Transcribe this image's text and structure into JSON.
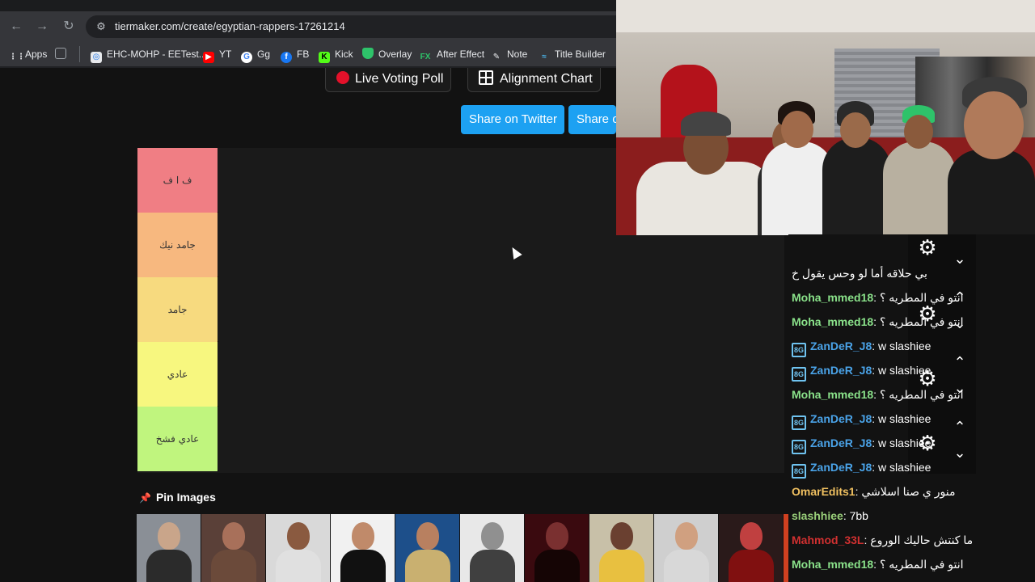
{
  "browser": {
    "url": "tiermaker.com/create/egyptian-rappers-17261214",
    "bookmarks": [
      {
        "label": "Apps",
        "icon": "apps-grid-icon"
      },
      {
        "label": "",
        "icon": "tab-groups-icon"
      },
      {
        "label": "EHC-MOHP - EETest...",
        "icon": "globe-icon"
      },
      {
        "label": "YT",
        "icon": "youtube-icon"
      },
      {
        "label": "Gg",
        "icon": "google-icon"
      },
      {
        "label": "FB",
        "icon": "facebook-icon"
      },
      {
        "label": "Kick",
        "icon": "kick-icon"
      },
      {
        "label": "Overlay",
        "icon": "shield-icon"
      },
      {
        "label": "After Effect",
        "icon": "fx-icon"
      },
      {
        "label": "Note",
        "icon": "note-icon"
      },
      {
        "label": "Title Builder",
        "icon": "wave-icon"
      }
    ]
  },
  "toolbar": {
    "live_voting": "Live Voting Poll",
    "alignment_chart": "Alignment Chart",
    "share_twitter": "Share on Twitter",
    "share_other": "Share o"
  },
  "tiers": [
    {
      "label": "ف ا ف",
      "color": "#f07e84"
    },
    {
      "label": "جامد نيك",
      "color": "#f7b87f"
    },
    {
      "label": "جامد",
      "color": "#f7da7f"
    },
    {
      "label": "عادي",
      "color": "#f7f77f"
    },
    {
      "label": "عادي فشخ",
      "color": "#c0f57e"
    }
  ],
  "pool": {
    "title": "Pin Images",
    "thumbs": [
      {
        "bg": "#8a8f96",
        "skin": "#c9a58a",
        "shirt": "#2b2b2b"
      },
      {
        "bg": "#5a4038",
        "skin": "#a8705a",
        "shirt": "#6b4a3a"
      },
      {
        "bg": "#d9d9d9",
        "skin": "#8a5a40",
        "shirt": "#e0e0e0"
      },
      {
        "bg": "#f1f1f1",
        "skin": "#c08a6a",
        "shirt": "#111111"
      },
      {
        "bg": "#1d4f8a",
        "skin": "#b88060",
        "shirt": "#c9b070"
      },
      {
        "bg": "#e8e8e8",
        "skin": "#909090",
        "shirt": "#404040"
      },
      {
        "bg": "#3a0a0f",
        "skin": "#7a3030",
        "shirt": "#150505"
      },
      {
        "bg": "#c8c0a8",
        "skin": "#6a4030",
        "shirt": "#e8c040"
      },
      {
        "bg": "#cfcfcf",
        "skin": "#d0a080",
        "shirt": "#d8d8d8"
      },
      {
        "bg": "#2a1a1a",
        "skin": "#c04040",
        "shirt": "#801010"
      },
      {
        "bg": "#d04020",
        "skin": "#c07050",
        "shirt": "#3060a0"
      },
      {
        "bg": "#2b7fb8",
        "skin": "#d0a080",
        "shirt": "#2a2a2a"
      },
      {
        "bg": "#0a0a0a",
        "skin": "#e07020",
        "shirt": "#200505"
      }
    ]
  },
  "chat": {
    "top_partial": "بي حلاقه أما لو وحس يقول خ",
    "messages": [
      {
        "user": "Moha_mmed18",
        "text": ": انتو في المطريه ؟",
        "color": "#8ae28a",
        "badge": false
      },
      {
        "user": "Moha_mmed18",
        "text": ": انتو في المطريه ؟",
        "color": "#8ae28a",
        "badge": false
      },
      {
        "user": "ZanDeR_J8",
        "text": ": w slashiee",
        "color": "#4aa3e8",
        "badge": true
      },
      {
        "user": "ZanDeR_J8",
        "text": ": w slashiee",
        "color": "#4aa3e8",
        "badge": true
      },
      {
        "user": "Moha_mmed18",
        "text": ": انتو في المطريه ؟",
        "color": "#8ae28a",
        "badge": false
      },
      {
        "user": "ZanDeR_J8",
        "text": ": w slashiee",
        "color": "#4aa3e8",
        "badge": true
      },
      {
        "user": "ZanDeR_J8",
        "text": ": w slashiee",
        "color": "#4aa3e8",
        "badge": true
      },
      {
        "user": "ZanDeR_J8",
        "text": ": w slashiee",
        "color": "#4aa3e8",
        "badge": true
      },
      {
        "user": "OmarEdits1",
        "text": ": منور ي صنا اسلاشي",
        "color": "#f0c060",
        "badge": false
      },
      {
        "user": "slashhiee",
        "text": ": 7bb",
        "color": "#9ad07a",
        "badge": false
      },
      {
        "user": "Mahmod_33L",
        "text": ": ما كنتش حاليك الوروع",
        "color": "#d03030",
        "badge": false
      },
      {
        "user": "Moha_mmed18",
        "text": ": انتو في المطريه ؟",
        "color": "#8ae28a",
        "badge": false
      }
    ]
  },
  "colors": {
    "accent_twitter": "#1da1f2",
    "page_bg": "#121212"
  }
}
